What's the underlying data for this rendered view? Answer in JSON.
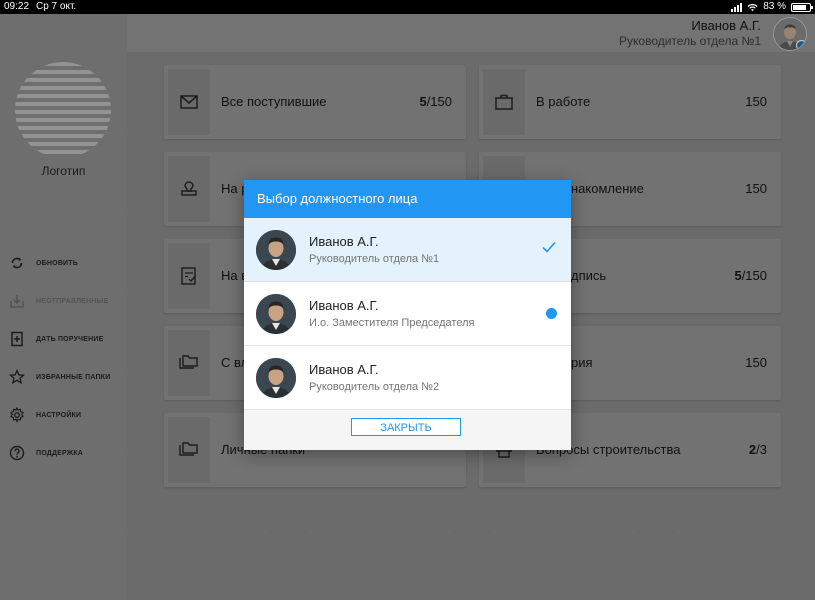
{
  "status_bar": {
    "time": "09:22",
    "date": "Ср 7 окт.",
    "battery_text": "83 %",
    "battery_level": 0.83
  },
  "sidebar": {
    "logo_label": "Логотип",
    "items": [
      {
        "label": "ОБНОВИТЬ",
        "icon": "refresh-icon",
        "enabled": true
      },
      {
        "label": "НЕОТПРАВЛЕННЫЕ",
        "icon": "outbox-icon",
        "enabled": false
      },
      {
        "label": "ДАТЬ ПОРУЧЕНИЕ",
        "icon": "add-document-icon",
        "enabled": true
      },
      {
        "label": "ИЗБРАННЫЕ ПАПКИ",
        "icon": "star-icon",
        "enabled": true
      },
      {
        "label": "НАСТРОЙКИ",
        "icon": "gear-icon",
        "enabled": true
      },
      {
        "label": "ПОДДЕРЖКА",
        "icon": "help-icon",
        "enabled": true
      }
    ]
  },
  "header": {
    "user_name": "Иванов А.Г.",
    "user_role": "Руководитель отдела №1"
  },
  "cards": [
    {
      "title": "Все поступившие",
      "count_bold": "5",
      "count_rest": "/150",
      "icon": "envelope-icon"
    },
    {
      "title": "В работе",
      "count_bold": "",
      "count_rest": "150",
      "icon": "briefcase-icon"
    },
    {
      "title": "На р",
      "count_bold": "",
      "count_rest": "",
      "icon": "stamp-icon"
    },
    {
      "title": "накомление",
      "count_bold": "",
      "count_rest": "150",
      "icon": "blank-icon"
    },
    {
      "title": "На в",
      "count_bold": "",
      "count_rest": "",
      "icon": "check-document-icon"
    },
    {
      "title": "дпись",
      "count_bold": "5",
      "count_rest": "/150",
      "icon": "blank-icon"
    },
    {
      "title": "С вл",
      "count_bold": "",
      "count_rest": "",
      "icon": "folders-icon"
    },
    {
      "title": "рия",
      "count_bold": "",
      "count_rest": "150",
      "icon": "blank-icon"
    },
    {
      "title": "Личные папки",
      "count_bold": "",
      "count_rest": "",
      "icon": "folders-icon"
    },
    {
      "title": "Вопросы строительства",
      "count_bold": "2",
      "count_rest": "/3",
      "icon": "construction-icon"
    }
  ],
  "dialog": {
    "title": "Выбор должностного лица",
    "options": [
      {
        "name": "Иванов А.Г.",
        "role": "Руководитель отдела №1",
        "state": "selected"
      },
      {
        "name": "Иванов А.Г.",
        "role": "И.о. Заместителя Председателя",
        "state": "current"
      },
      {
        "name": "Иванов А.Г.",
        "role": "Руководитель отдела №2",
        "state": "none"
      }
    ],
    "close_label": "ЗАКРЫТЬ"
  },
  "colors": {
    "accent": "#2196f3",
    "overlay_gray": "#6e6e6e",
    "selected_row": "#e3f2fd"
  }
}
